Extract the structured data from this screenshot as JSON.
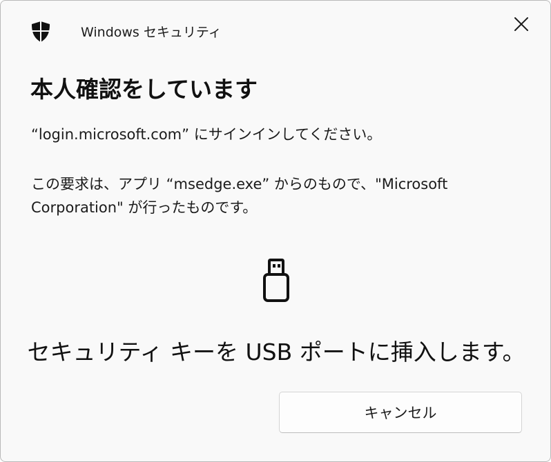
{
  "window": {
    "app_title": "Windows セキュリティ",
    "close_icon": "close-icon",
    "app_icon": "shield-icon"
  },
  "content": {
    "heading": "本人確認をしています",
    "site_message": "“login.microsoft.com” にサインインしてください。",
    "request_message": "この要求は、アプリ “msedge.exe” からのもので、\"Microsoft Corporation\" が行ったものです。",
    "device_icon": "usb-key-icon",
    "instruction": "セキュリティ キーを USB ポートに挿入します。"
  },
  "actions": {
    "cancel_label": "キャンセル"
  },
  "colors": {
    "background": "#f9f9f9",
    "text": "#1b1b1b",
    "button_border": "#d4d4d4"
  }
}
